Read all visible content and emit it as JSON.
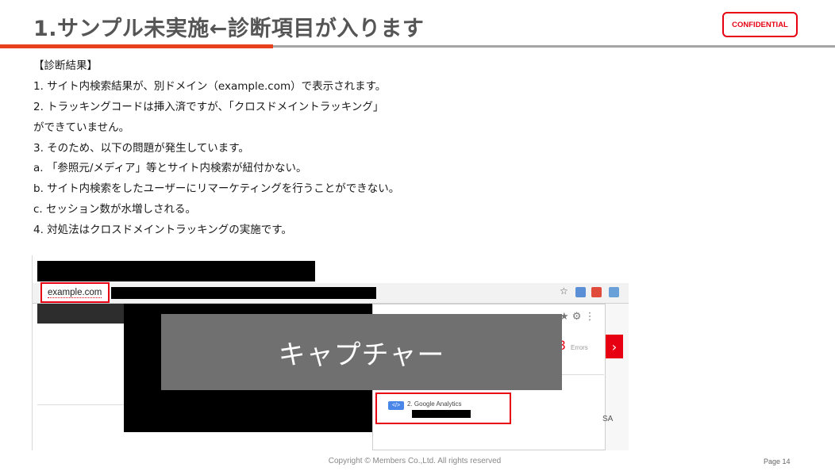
{
  "header": {
    "title": "1.サンプル未実施←診断項目が入ります",
    "confidential": "CONFIDENTIAL"
  },
  "body": {
    "lines": [
      "【診断結果】",
      "1. サイト内検索結果が、別ドメイン（example.com）で表示されます。",
      "2. トラッキングコードは挿入済ですが、「クロスドメイントラッキング」",
      "ができていません。",
      "3. そのため、以下の問題が発生しています。",
      "a. 「参照元/メディア」等とサイト内検索が紐付かない。",
      "b. サイト内検索をしたユーザーにリマーケティングを行うことができない。",
      "c. セッション数が水増しされる。",
      "4. 対処法はクロスドメイントラッキングの実施です。"
    ]
  },
  "screenshot": {
    "url_text": "example.com",
    "overlay_label": "キャプチャー",
    "error_count": "3",
    "error_label": "Errors",
    "ga_tag": "</>",
    "ga_text": "2.   Google Analytics",
    "side_text": "SA",
    "colors": {
      "highlight": "#e60012",
      "overlay": "#707070"
    }
  },
  "footer": {
    "copyright": "Copyright © Members Co.,Ltd. All rights reserved",
    "page": "Page 14"
  }
}
